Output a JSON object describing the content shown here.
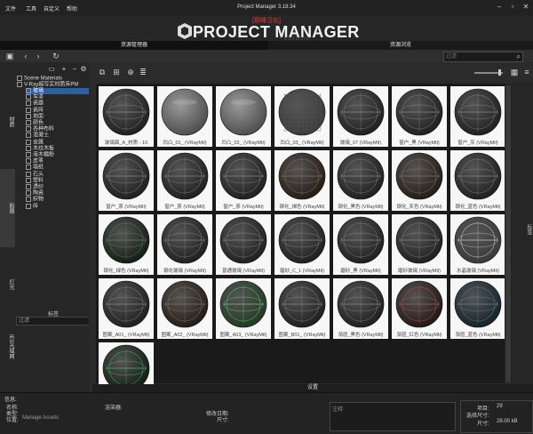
{
  "window": {
    "title": "Project Manager 3.18.34",
    "menu": [
      "文件",
      "工具",
      "自定义",
      "帮助"
    ],
    "controls": [
      "minimize",
      "maximize",
      "close"
    ]
  },
  "banner": {
    "tag": "[巅峰汉化]",
    "title": "PROJECT MANAGER",
    "watermark": "KSTUDIO"
  },
  "tabs": {
    "resource_manager": "资源管理器",
    "resource_browse": "资源浏览"
  },
  "search": {
    "placeholder": "过滤"
  },
  "side_tabs": {
    "materials": "材质",
    "maps": "贴图",
    "lights": "灯光",
    "ies": "IES光域网"
  },
  "tree": {
    "root1": "Scene Materials",
    "root2": "V-Ray超写实材质库PM",
    "items": [
      "玻璃",
      "车漆",
      "瓷器",
      "瓷砖",
      "地面",
      "颜色",
      "各种布料",
      "混凝土",
      "金属",
      "木纹木板",
      "液木糯粉",
      "皮革",
      "墙纸",
      "石头",
      "塑料",
      "透纱",
      "陶瓷",
      "织物",
      "砖"
    ],
    "selected_index": 0,
    "lower_label": "标签",
    "lower_filter": "过滤"
  },
  "materials": [
    {
      "label": "玻璃面_A_材质 - 10"
    },
    {
      "label": "凹凸_01_ (VRayMtl)"
    },
    {
      "label": "凹凸_02_ (VRayMtl)"
    },
    {
      "label": "凹凸_03_ (VRayMtl)"
    },
    {
      "label": "玻璃_07 (VRayMtl)"
    },
    {
      "label": "窗户_黑 (VRayMtl)"
    },
    {
      "label": "窗户_灰 (VRayMtl)"
    },
    {
      "label": "窗户_茶 (VRayMtl)"
    },
    {
      "label": "窗户_茶 (VRayMtl)"
    },
    {
      "label": "窗户_茶 (VRayMtl)"
    },
    {
      "label": "钢化_褐色 (VRayMtl)"
    },
    {
      "label": "钢化_黑色 (VRayMtl)"
    },
    {
      "label": "钢化_灰色 (VRayMtl)"
    },
    {
      "label": "钢化_蓝色 (VRayMtl)"
    },
    {
      "label": "钢化_绿色 (VRayMtl)"
    },
    {
      "label": "钢化玻璃 (VRayMtl)"
    },
    {
      "label": "普通玻璃 (VRayMtl)"
    },
    {
      "label": "磨砂_C_1 (VRayMtl)"
    },
    {
      "label": "磨砂_黑 (VRayMtl)"
    },
    {
      "label": "磨砂玻璃 (VRayMtl)"
    },
    {
      "label": "水晶玻璃 (VRayMtl)"
    },
    {
      "label": "图案_A01_ (VRayMtl)"
    },
    {
      "label": "图案_A02_ (VRayMtl)"
    },
    {
      "label": "图案_A03_ (VRayMtl)"
    },
    {
      "label": "图案_B01_ (VRayMtl)"
    },
    {
      "label": "渐层_黑色 (VRayMtl)"
    },
    {
      "label": "渐层_红色 (VRayMtl)"
    },
    {
      "label": "渐层_蓝色 (VRayMtl)"
    },
    {
      "label": ""
    }
  ],
  "settings_label": "设置",
  "info": {
    "header": "信息:",
    "name_label": "名称:",
    "type_label": "类型:",
    "location_label": "位置:",
    "location_value": "Manage Assets",
    "renderer_label": "渲染器:",
    "modified_label": "修改日期:",
    "size_label": "尺寸:",
    "notes_placeholder": "注释",
    "count_label": "项目:",
    "count_value": "29",
    "selected_label": "选择尺寸:",
    "total_label": "尺寸:",
    "total_value": "28.00 kB"
  }
}
